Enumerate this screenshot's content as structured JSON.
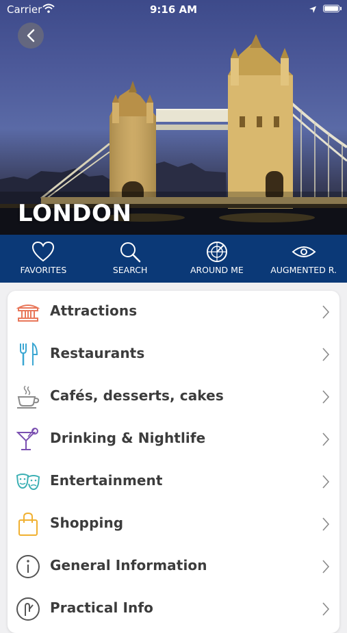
{
  "status_bar": {
    "carrier": "Carrier",
    "time": "9:16 AM",
    "icons": [
      "wifi-icon",
      "location-arrow-icon",
      "battery-icon"
    ]
  },
  "hero": {
    "title": "LONDON",
    "back_icon": "chevron-left-icon"
  },
  "nav": {
    "items": [
      {
        "label": "FAVORITES",
        "icon": "heart-icon"
      },
      {
        "label": "SEARCH",
        "icon": "search-icon"
      },
      {
        "label": "AROUND ME",
        "icon": "radar-icon"
      },
      {
        "label": "AUGMENTED R.",
        "icon": "eye-icon"
      }
    ]
  },
  "categories": {
    "items": [
      {
        "label": "Attractions",
        "icon": "museum-icon",
        "color": "#e8775a"
      },
      {
        "label": "Restaurants",
        "icon": "fork-knife-icon",
        "color": "#3aa6d2"
      },
      {
        "label": "Cafés, desserts, cakes",
        "icon": "coffee-cup-icon",
        "color": "#8a8a8a"
      },
      {
        "label": "Drinking & Nightlife",
        "icon": "cocktail-icon",
        "color": "#7a4fb0"
      },
      {
        "label": "Entertainment",
        "icon": "theater-masks-icon",
        "color": "#3cb0b4"
      },
      {
        "label": "Shopping",
        "icon": "shopping-bag-icon",
        "color": "#f0b030"
      },
      {
        "label": "General Information",
        "icon": "info-icon",
        "color": "#555555"
      },
      {
        "label": "Practical Info",
        "icon": "practical-info-icon",
        "color": "#555555"
      }
    ],
    "chevron_icon": "chevron-right-icon"
  }
}
